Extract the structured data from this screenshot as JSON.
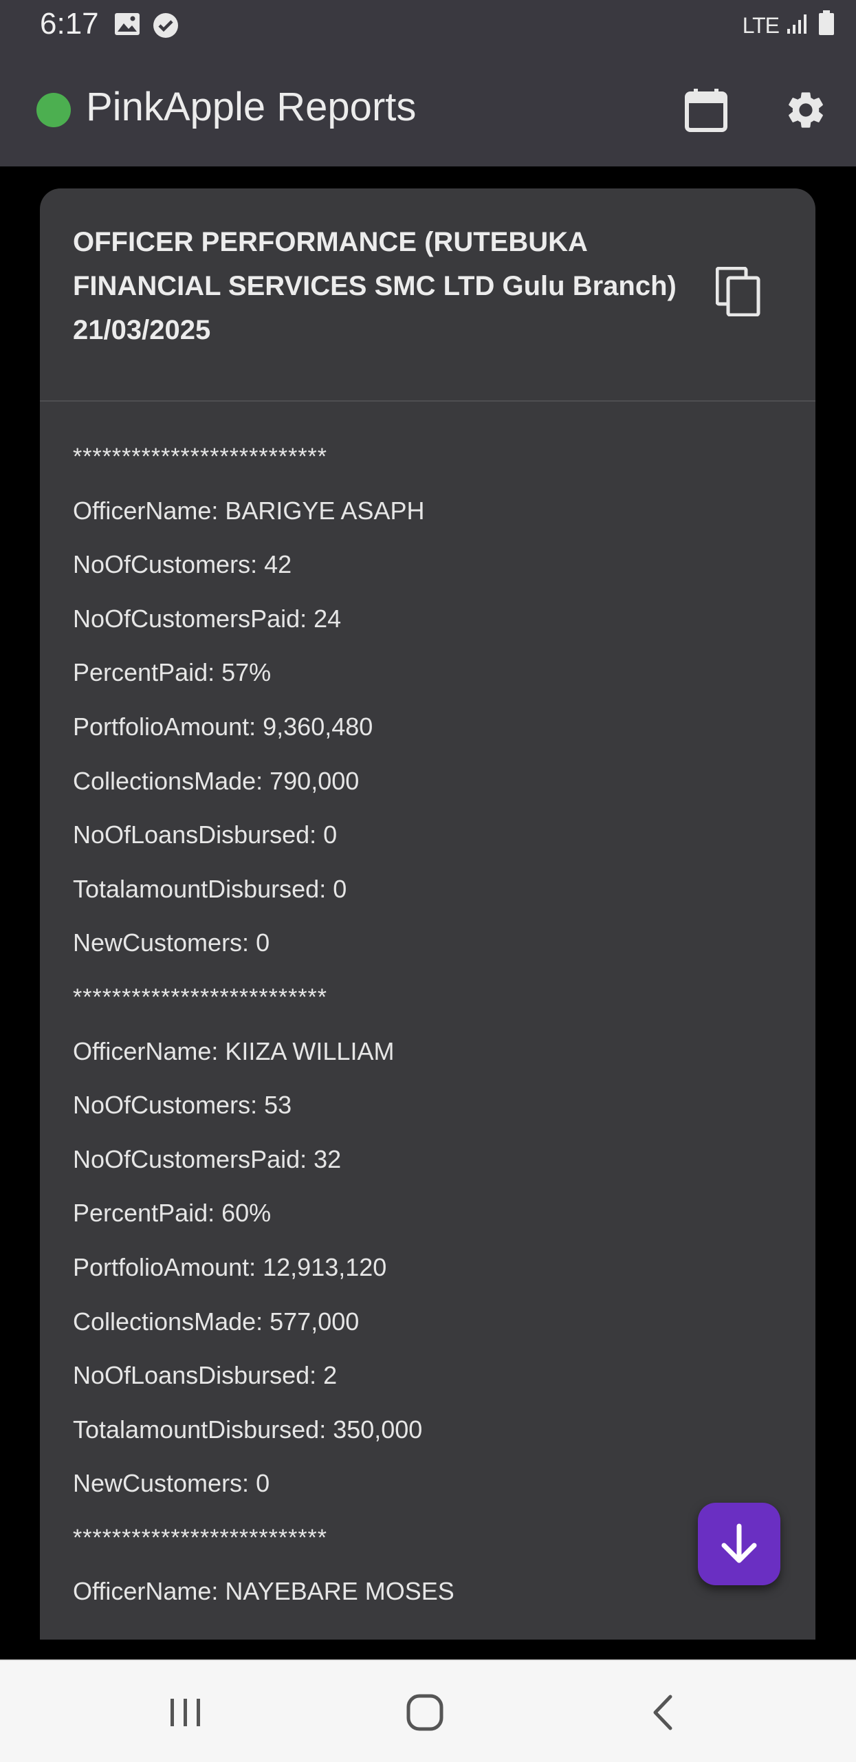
{
  "status_bar": {
    "time": "6:17",
    "network": "LTE",
    "icons": [
      "image-icon",
      "check-circle-icon",
      "signal-icon",
      "battery-icon"
    ]
  },
  "app_bar": {
    "title": "PinkApple Reports",
    "status_dot_color": "#4caf50",
    "actions": [
      "calendar-icon",
      "settings-icon"
    ]
  },
  "report": {
    "title": "OFFICER PERFORMANCE (RUTEBUKA FINANCIAL SERVICES SMC LTD Gulu Branch) 21/03/2025",
    "lines": [
      "**************************",
      "OfficerName: BARIGYE ASAPH",
      "NoOfCustomers: 42",
      "NoOfCustomersPaid: 24",
      "PercentPaid: 57%",
      "PortfolioAmount: 9,360,480",
      "CollectionsMade: 790,000",
      "NoOfLoansDisbursed: 0",
      "TotalamountDisbursed: 0",
      "NewCustomers: 0",
      "**************************",
      "OfficerName: KIIZA WILLIAM",
      "NoOfCustomers: 53",
      "NoOfCustomersPaid: 32",
      "PercentPaid: 60%",
      "PortfolioAmount: 12,913,120",
      "CollectionsMade: 577,000",
      "NoOfLoansDisbursed: 2",
      "TotalamountDisbursed: 350,000",
      "NewCustomers: 0",
      "**************************",
      "OfficerName: NAYEBARE MOSES"
    ]
  },
  "fab": {
    "icon": "arrow-down-icon",
    "color": "#6a2fc2"
  },
  "nav_bar": {
    "buttons": [
      "recent-apps-icon",
      "home-icon",
      "back-icon"
    ]
  }
}
